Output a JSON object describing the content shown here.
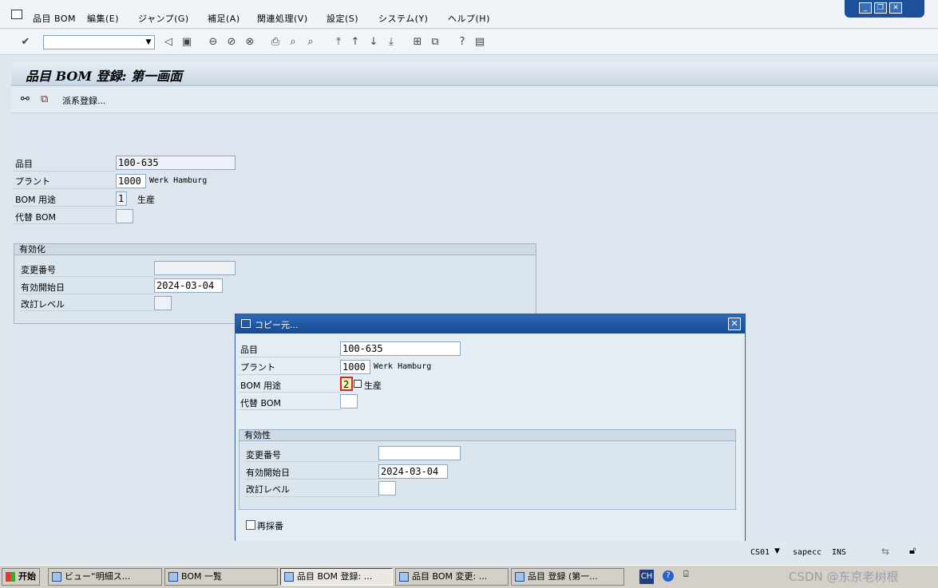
{
  "menubar": {
    "items": [
      "品目 BOM",
      "編集(E)",
      "ジャンプ(G)",
      "補足(A)",
      "関連処理(V)",
      "設定(S)",
      "システム(Y)",
      "ヘルプ(H)"
    ]
  },
  "window_controls": {
    "minimize": "_",
    "restore": "❐",
    "close": "✕"
  },
  "toolbar": {
    "icons": [
      "check-icon",
      "back-icon",
      "save-icon",
      "back-nav-icon",
      "exit-icon",
      "cancel-icon",
      "print-icon",
      "find-icon",
      "find-next-icon",
      "first-page-icon",
      "prev-page-icon",
      "next-page-icon",
      "last-page-icon",
      "new-session-icon",
      "shortcut-icon",
      "help-icon",
      "layout-icon"
    ]
  },
  "page": {
    "title": "品目 BOM 登録: 第一画面"
  },
  "apptoolbar": {
    "derive_label": "派系登録..."
  },
  "main_form": {
    "material_label": "品目",
    "material_value": "100-635",
    "plant_label": "プラント",
    "plant_value": "1000",
    "plant_desc": "Werk Hamburg",
    "usage_label": "BOM 用途",
    "usage_value": "1",
    "usage_desc": "生産",
    "alt_label": "代替 BOM",
    "alt_value": "",
    "group_title": "有効化",
    "change_no_label": "変更番号",
    "change_no_value": "",
    "valid_from_label": "有効開始日",
    "valid_from_value": "2024-03-04",
    "revision_label": "改訂レベル",
    "revision_value": ""
  },
  "dialog": {
    "title": "コピー元...",
    "material_label": "品目",
    "material_value": "100-635",
    "plant_label": "プラント",
    "plant_value": "1000",
    "plant_desc": "Werk Hamburg",
    "usage_label": "BOM 用途",
    "usage_value": "2",
    "usage_desc": "生産",
    "alt_label": "代替 BOM",
    "alt_value": "",
    "group_title": "有効性",
    "change_no_label": "変更番号",
    "change_no_value": "",
    "valid_from_label": "有効開始日",
    "valid_from_value": "2024-03-04",
    "revision_label": "改訂レベル",
    "revision_value": "",
    "renumber_label": "再採番"
  },
  "statusbar": {
    "transaction": "CS01",
    "server": "sapecc",
    "mode": "INS"
  },
  "taskbar": {
    "start_label": "开始",
    "tasks": [
      "ビュー“明細ス...",
      "BOM 一覧",
      "品目 BOM 登録: ...",
      "品目 BOM 変更: ...",
      "品目 登録 (第一..."
    ],
    "lang": "CH",
    "watermark": "CSDN @东京老树根"
  }
}
